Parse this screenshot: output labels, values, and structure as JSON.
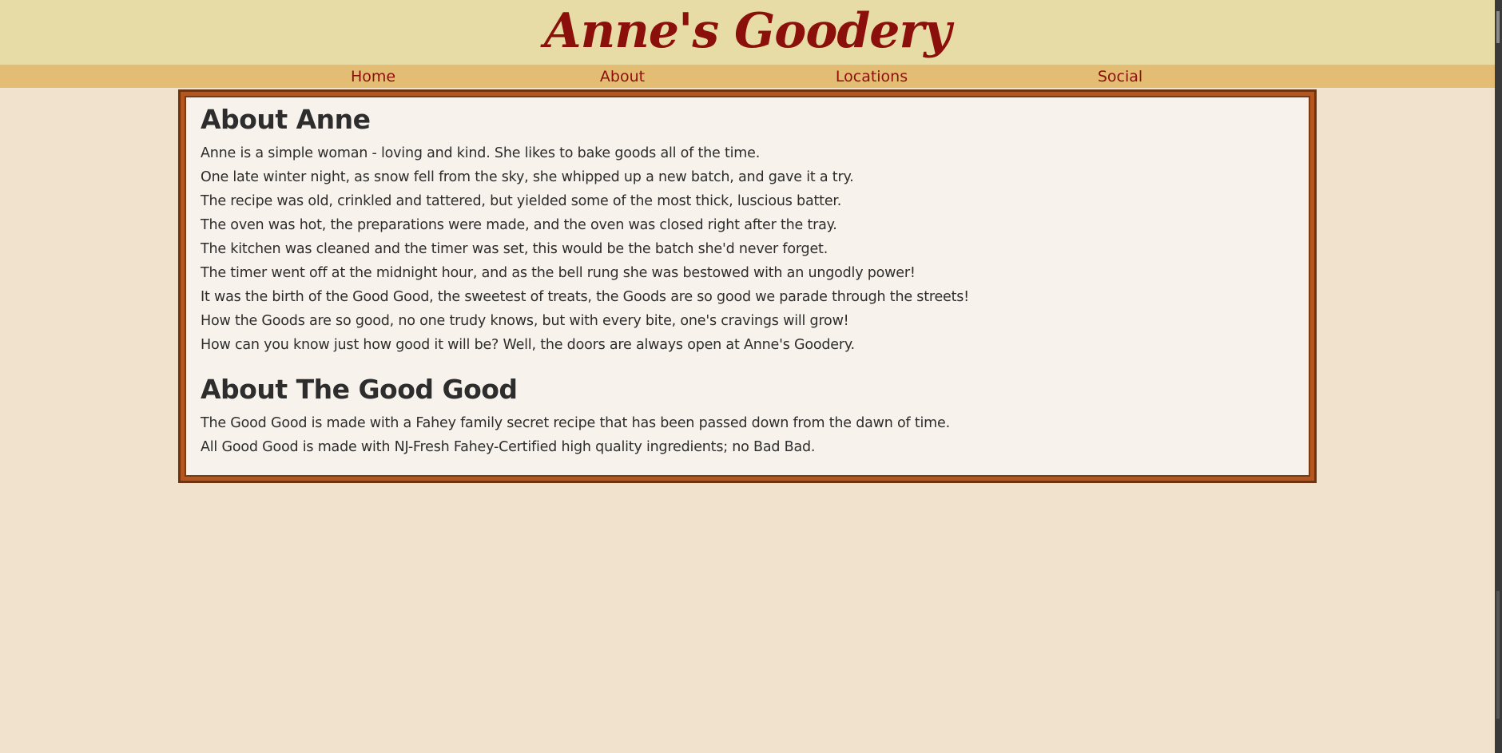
{
  "site": {
    "title": "Anne's Goodery"
  },
  "nav": {
    "items": [
      {
        "label": "Home"
      },
      {
        "label": "About"
      },
      {
        "label": "Locations"
      },
      {
        "label": "Social"
      }
    ]
  },
  "content": {
    "sections": [
      {
        "heading": "About Anne",
        "lines": [
          "Anne is a simple woman - loving and kind. She likes to bake goods all of the time.",
          "One late winter night, as snow fell from the sky, she whipped up a new batch, and gave it a try.",
          "The recipe was old, crinkled and tattered, but yielded some of the most thick, luscious batter.",
          "The oven was hot, the preparations were made, and the oven was closed right after the tray.",
          "The kitchen was cleaned and the timer was set, this would be the batch she'd never forget.",
          "The timer went off at the midnight hour, and as the bell rung she was bestowed with an ungodly power!",
          "It was the birth of the Good Good, the sweetest of treats, the Goods are so good we parade through the streets!",
          "How the Goods are so good, no one trudy knows, but with every bite, one's cravings will grow!",
          "How can you know just how good it will be? Well, the doors are always open at Anne's Goodery."
        ]
      },
      {
        "heading": "About The Good Good",
        "lines": [
          "The Good Good is made with a Fahey family secret recipe that has been passed down from the dawn of time.",
          "All Good Good is made with NJ-Fresh Fahey-Certified high quality ingredients; no Bad Bad."
        ]
      }
    ]
  },
  "colors": {
    "header_bg": "#e8dca6",
    "nav_bg": "#e3bd73",
    "page_bg": "#f0e2cc",
    "brand_red": "#8b0f0a",
    "frame_brown": "#b4561f",
    "content_bg": "#f7f2eb"
  }
}
